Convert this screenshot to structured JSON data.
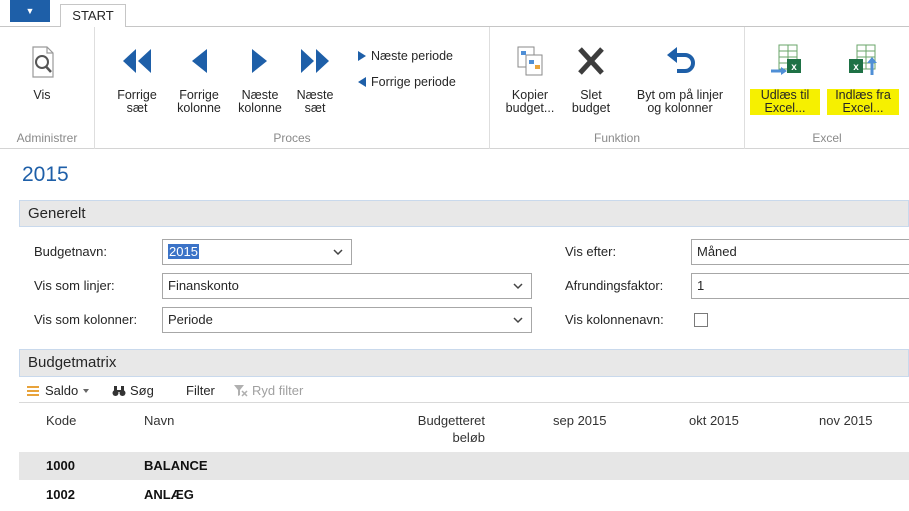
{
  "tabs": {
    "app_menu_glyph": "▼",
    "start": "START"
  },
  "ribbon": {
    "administrer": {
      "label": "Administrer",
      "vis": "Vis"
    },
    "proces": {
      "label": "Proces",
      "forrige_saet": [
        "Forrige",
        "sæt"
      ],
      "forrige_kolonne": [
        "Forrige",
        "kolonne"
      ],
      "naeste_kolonne": [
        "Næste",
        "kolonne"
      ],
      "naeste_saet": [
        "Næste",
        "sæt"
      ],
      "naeste_periode": "Næste periode",
      "forrige_periode": "Forrige periode"
    },
    "funktion": {
      "label": "Funktion",
      "kopier": [
        "Kopier",
        "budget..."
      ],
      "slet": [
        "Slet",
        "budget"
      ],
      "byt": [
        "Byt om på linjer",
        "og kolonner"
      ]
    },
    "excel": {
      "label": "Excel",
      "udlaes": [
        "Udlæs til",
        "Excel..."
      ],
      "indlaes": [
        "Indlæs fra",
        "Excel..."
      ]
    }
  },
  "page_title": "2015",
  "generelt": {
    "header": "Generelt",
    "budgetnavn_label": "Budgetnavn:",
    "budgetnavn_value": "2015",
    "vis_som_linjer_label": "Vis som linjer:",
    "vis_som_linjer_value": "Finanskonto",
    "vis_som_kolonner_label": "Vis som kolonner:",
    "vis_som_kolonner_value": "Periode",
    "vis_efter_label": "Vis efter:",
    "vis_efter_value": "Måned",
    "afrundingsfaktor_label": "Afrundingsfaktor:",
    "afrundingsfaktor_value": "1",
    "vis_kolonnenavn_label": "Vis kolonnenavn:",
    "vis_kolonnenavn_checked": false
  },
  "budgetmatrix": {
    "header": "Budgetmatrix",
    "toolbar": {
      "saldo": "Saldo",
      "soeg": "Søg",
      "filter": "Filter",
      "ryd_filter": "Ryd filter"
    },
    "columns": {
      "kode": "Kode",
      "navn": "Navn",
      "budgetteret": [
        "Budgetteret",
        "beløb"
      ],
      "sep": "sep 2015",
      "okt": "okt 2015",
      "nov": "nov 2015"
    },
    "rows": [
      {
        "kode": "1000",
        "navn": "BALANCE"
      },
      {
        "kode": "1002",
        "navn": "ANLÆG"
      }
    ]
  },
  "colors": {
    "accent": "#1e5fa8",
    "highlight": "#f6f000",
    "excel_green": "#1e7145"
  }
}
